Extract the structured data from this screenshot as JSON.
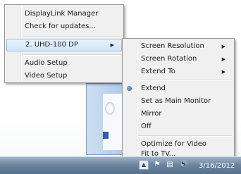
{
  "left_menu": {
    "items": [
      {
        "label": "DisplayLink Manager"
      },
      {
        "label": "Check for updates..."
      },
      {
        "label": "2. UHD-100 DP",
        "submenu": true,
        "highlighted": true
      },
      {
        "label": "Audio Setup"
      },
      {
        "label": "Video Setup"
      }
    ]
  },
  "right_menu": {
    "items": [
      {
        "label": "Screen Resolution",
        "submenu": true
      },
      {
        "label": "Screen Rotation",
        "submenu": true
      },
      {
        "label": "Extend To",
        "submenu": true
      },
      {
        "label": "Extend",
        "selected": true
      },
      {
        "label": "Set as Main Monitor"
      },
      {
        "label": "Mirror"
      },
      {
        "label": "Off"
      },
      {
        "label": "Optimize for Video"
      },
      {
        "label": "Fit to TV..."
      }
    ]
  },
  "taskbar": {
    "clock": "3/16/2012",
    "icons": [
      "show-hidden-icons-icon",
      "action-center-flag-icon",
      "network-icon",
      "volume-icon"
    ]
  }
}
